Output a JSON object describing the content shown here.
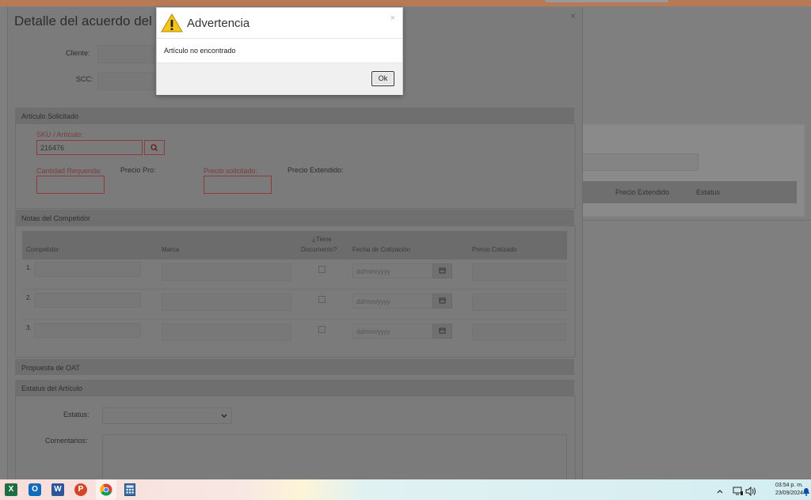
{
  "alert": {
    "title": "Advertencia",
    "message": "Artículo no encontrado",
    "ok_label": "Ok",
    "close_glyph": "×"
  },
  "modal": {
    "title": "Detalle del acuerdo del pre",
    "close_glyph": "×",
    "cliente_label": "Cliente:",
    "scc_label": "SCC:",
    "articulo_section": "Artículo Solicitado",
    "sku_label": "SKU / Artículo:",
    "sku_value": "216476",
    "cantidad_label": "Cantidad Requerida:",
    "precio_pro_label": "Precio Pro:",
    "precio_solicitado_label": "Precio solicitado:",
    "precio_extendido_label": "Precio Extendido:",
    "competidor_section": "Notas del Competidor",
    "table_headers": {
      "competidor": "Competidor",
      "marca": "Marca",
      "tiene_documento_line1": "¿Tiene",
      "tiene_documento_line2": "Documento?",
      "fecha": "Fecha de Cotización",
      "precio_cotizado": "Precio Cotizado"
    },
    "rows": [
      {
        "num": "1.",
        "date_placeholder": "dd/mm/yyyy"
      },
      {
        "num": "2.",
        "date_placeholder": "dd/mm/yyyy"
      },
      {
        "num": "3.",
        "date_placeholder": "dd/mm/yyyy"
      }
    ],
    "propuesta_section": "Propuesta de OAT",
    "estatus_section": "Estatus del Artículo",
    "estatus_label": "Estatus:",
    "comentarios_label": "Comentarios:"
  },
  "background": {
    "right_headers": [
      "Precio Extendido",
      "Estatus"
    ]
  },
  "taskbar": {
    "time": "03:54 p. m.",
    "date": "23/09/2024"
  }
}
